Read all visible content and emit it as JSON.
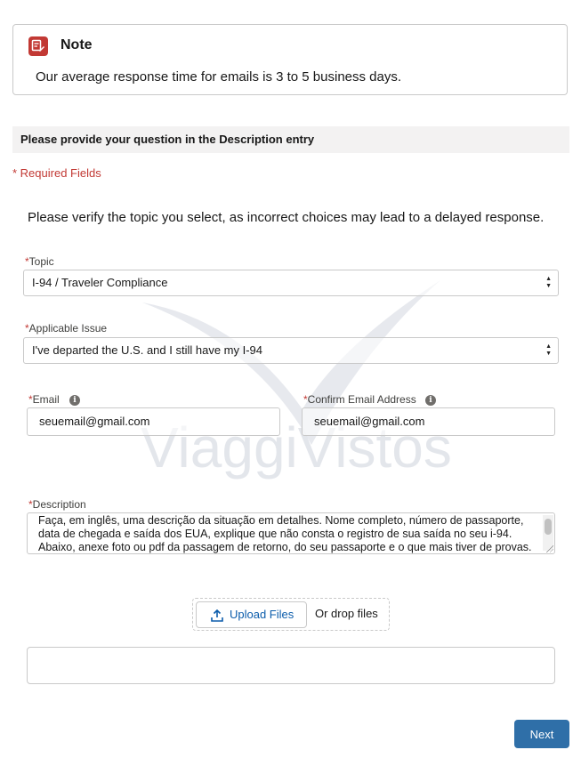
{
  "note": {
    "title": "Note",
    "text": "Our average response time for emails is 3 to 5 business days."
  },
  "section_header": "Please provide your question in the Description entry",
  "required_note": "* Required Fields",
  "verify_text": "Please verify the topic you select, as incorrect choices may lead to a delayed response.",
  "form": {
    "topic": {
      "label": "Topic",
      "value": "I-94 / Traveler Compliance"
    },
    "issue": {
      "label": "Applicable Issue",
      "value": "I've departed the U.S. and I still have my I-94"
    },
    "email": {
      "label": "Email",
      "value": "seuemail@gmail.com"
    },
    "confirm_email": {
      "label": "Confirm Email Address",
      "value": "seuemail@gmail.com"
    },
    "description": {
      "label": "Description",
      "value": "Faça, em inglês, uma descrição da situação em detalhes. Nome completo, número de passaporte, data de chegada e saída dos EUA, explique que não consta o registro de sua saída no seu i-94. Abaixo, anexe foto ou pdf da passagem de retorno, do seu passaporte e o que mais tiver de provas."
    },
    "required_mark": "*",
    "info_glyph": "i"
  },
  "upload": {
    "button_label": "Upload Files",
    "drop_text": "Or drop files"
  },
  "next_label": "Next",
  "watermark_text": "ViaggiVistos",
  "colors": {
    "required": "#c23934",
    "note_icon_bg": "#c23934",
    "primary": "#2f6fa8",
    "link": "#0b5cab"
  }
}
